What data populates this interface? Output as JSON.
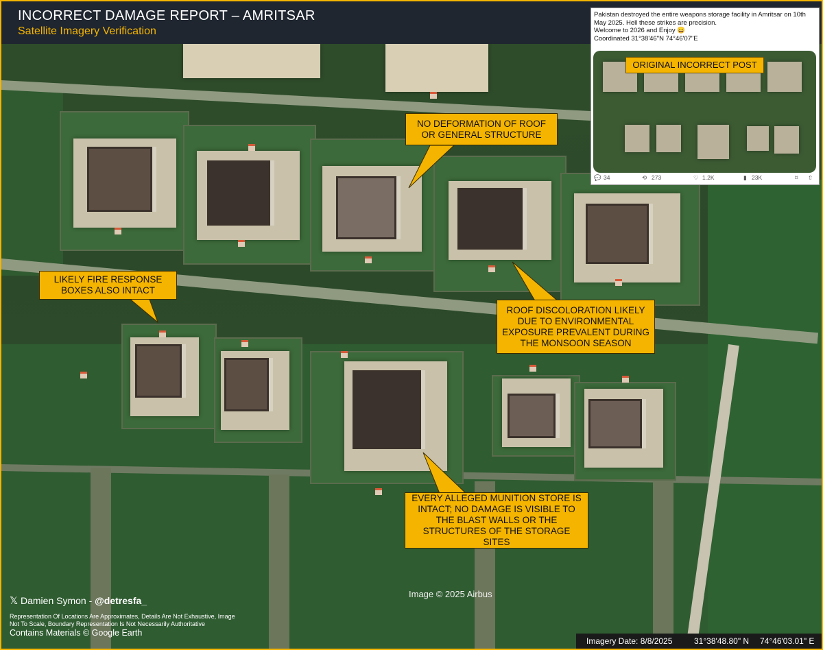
{
  "header": {
    "title": "INCORRECT DAMAGE REPORT – AMRITSAR",
    "subtitle": "Satellite Imagery Verification"
  },
  "callouts": {
    "roof_structure": "NO DEFORMATION OF ROOF OR GENERAL STRUCTURE",
    "fire_boxes": "LIKELY FIRE RESPONSE BOXES ALSO INTACT",
    "discoloration": "ROOF DISCOLORATION LIKELY DUE TO ENVIRONMENTAL EXPOSURE PREVALENT DURING THE MONSOON SEASON",
    "munition": "EVERY ALLEGED MUNITION STORE IS INTACT; NO DAMAGE IS VISIBLE TO THE BLAST WALLS OR THE STRUCTURES OF THE STORAGE SITES"
  },
  "inset": {
    "post_text": "Pakistan destroyed the entire weapons storage facility in Amritsar on 10th May 2025. Hell these strikes are precision.",
    "post_line2": "Welcome to 2026 and Enjoy 😄",
    "post_line3": "Coordinated 31°38'46\"N 74°46'07\"E",
    "label": "ORIGINAL INCORRECT POST",
    "stats": {
      "replies": "34",
      "reposts": "273",
      "likes": "1.2K",
      "views": "23K"
    }
  },
  "footer": {
    "author_name": "Damien Symon - ",
    "author_handle": "@detresfa_",
    "disclaimer": "Representation Of Locations Are Approximates, Details Are Not Exhaustive, Image Not To Scale, Boundary Representation Is Not Necessarily Authoritative",
    "contains": "Contains Materials © Google Earth",
    "image_credit": "Image © 2025 Airbus",
    "imagery_date": "Imagery Date: 8/8/2025",
    "lat": "31°38'48.80\" N",
    "lon": "74°46'03.01\" E"
  },
  "colors": {
    "accent": "#f4b400",
    "header_bg": "#1f2630"
  }
}
